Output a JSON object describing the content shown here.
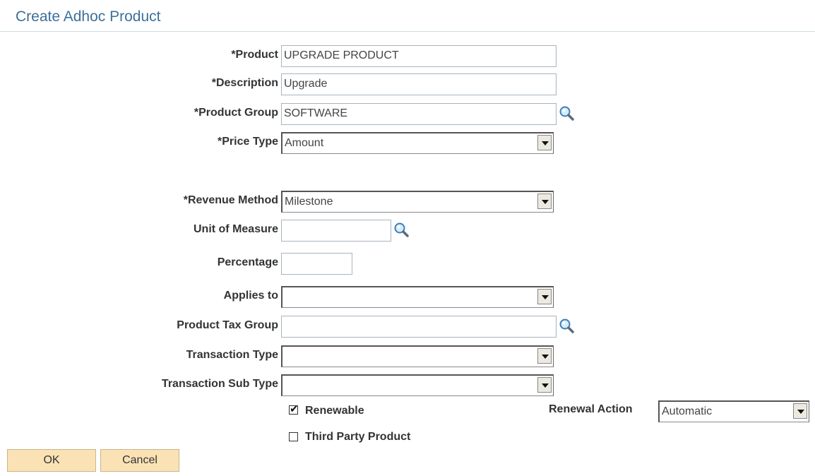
{
  "page": {
    "title": "Create Adhoc Product"
  },
  "form": {
    "product": {
      "label": "*Product",
      "value": "UPGRADE PRODUCT"
    },
    "description": {
      "label": "*Description",
      "value": "Upgrade"
    },
    "product_group": {
      "label": "*Product Group",
      "value": "SOFTWARE"
    },
    "price_type": {
      "label": "*Price Type",
      "value": "Amount"
    },
    "revenue_method": {
      "label": "*Revenue Method",
      "value": "Milestone"
    },
    "unit_of_measure": {
      "label": "Unit of Measure",
      "value": ""
    },
    "percentage": {
      "label": "Percentage",
      "value": ""
    },
    "applies_to": {
      "label": "Applies to",
      "value": ""
    },
    "product_tax_group": {
      "label": "Product Tax Group",
      "value": ""
    },
    "transaction_type": {
      "label": "Transaction Type",
      "value": ""
    },
    "transaction_sub_type": {
      "label": "Transaction Sub Type",
      "value": ""
    },
    "renewable": {
      "label": "Renewable",
      "checked": true
    },
    "third_party_product": {
      "label": "Third Party Product",
      "checked": false
    },
    "renewal_action": {
      "label": "Renewal Action",
      "value": "Automatic"
    }
  },
  "buttons": {
    "ok_label": "OK",
    "cancel_label": "Cancel"
  },
  "icons": {
    "lookup": "magnifier-icon",
    "dropdown": "dropdown-arrow-icon",
    "check": "checkmark-icon"
  }
}
